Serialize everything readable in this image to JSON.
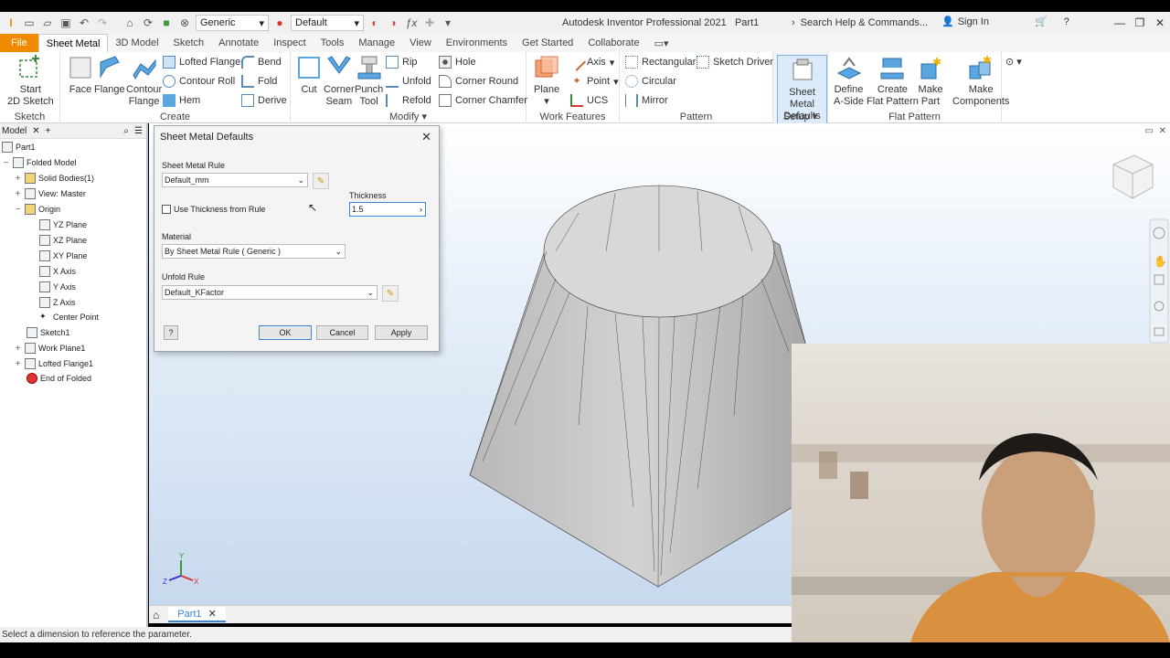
{
  "titlebar": {
    "material_combo": "Generic",
    "appearance_combo": "Default",
    "title": "Autodesk Inventor Professional 2021",
    "document": "Part1",
    "search_placeholder": "Search Help & Commands...",
    "signin": "Sign In"
  },
  "tabs": [
    "File",
    "Sheet Metal",
    "3D Model",
    "Sketch",
    "Annotate",
    "Inspect",
    "Tools",
    "Manage",
    "View",
    "Environments",
    "Get Started",
    "Collaborate"
  ],
  "ribbon": {
    "sketch": {
      "start": "Start",
      "start2": "2D Sketch",
      "title": "Sketch"
    },
    "create": {
      "face": "Face",
      "flange": "Flange",
      "contour": "Contour",
      "contour2": "Flange",
      "lofted_flange": "Lofted Flange",
      "contour_roll": "Contour Roll",
      "hem": "Hem",
      "bend": "Bend",
      "fold": "Fold",
      "derive": "Derive",
      "title": "Create"
    },
    "modify": {
      "cut": "Cut",
      "corner": "Corner",
      "corner2": "Seam",
      "punch": "Punch",
      "punch2": "Tool",
      "rip": "Rip",
      "unfold": "Unfold",
      "refold": "Refold",
      "hole": "Hole",
      "corner_round": "Corner Round",
      "corner_chamfer": "Corner Chamfer",
      "title": "Modify"
    },
    "work": {
      "plane": "Plane",
      "axis": "Axis",
      "point": "Point",
      "ucs": "UCS",
      "title": "Work Features"
    },
    "pattern": {
      "rectangular": "Rectangular",
      "circular": "Circular",
      "mirror": "Mirror",
      "sketch_driven": "Sketch Driven",
      "title": "Pattern"
    },
    "setup": {
      "label1": "Sheet Metal",
      "label2": "Defaults",
      "title": "Setup"
    },
    "flat": {
      "define1": "Define",
      "define2": "A-Side",
      "create1": "Create",
      "create2": "Flat Pattern",
      "make_part1": "Make",
      "make_part2": "Part",
      "make_comp1": "Make",
      "make_comp2": "Components",
      "title": "Flat Pattern"
    }
  },
  "browser": {
    "tab": "Model",
    "items": [
      "Part1",
      "Folded Model",
      "Solid Bodies(1)",
      "View: Master",
      "Origin",
      "YZ Plane",
      "XZ Plane",
      "XY Plane",
      "X Axis",
      "Y Axis",
      "Z Axis",
      "Center Point",
      "Sketch1",
      "Work Plane1",
      "Lofted Flange1",
      "End of Folded"
    ]
  },
  "dialog": {
    "title": "Sheet Metal Defaults",
    "rule_label": "Sheet Metal Rule",
    "rule_value": "Default_mm",
    "use_thickness": "Use Thickness from Rule",
    "thickness_label": "Thickness",
    "thickness_value": "1.5",
    "material_label": "Material",
    "material_value": "By Sheet Metal Rule ( Generic )",
    "unfold_label": "Unfold Rule",
    "unfold_value": "Default_KFactor",
    "ok": "OK",
    "cancel": "Cancel",
    "apply": "Apply"
  },
  "document_tab": "Part1",
  "status": "Select a dimension to reference the parameter.",
  "colors": {
    "file_tab": "#f08a00",
    "viewport_top": "#ffffff",
    "viewport_bottom": "#c7d9ee"
  }
}
